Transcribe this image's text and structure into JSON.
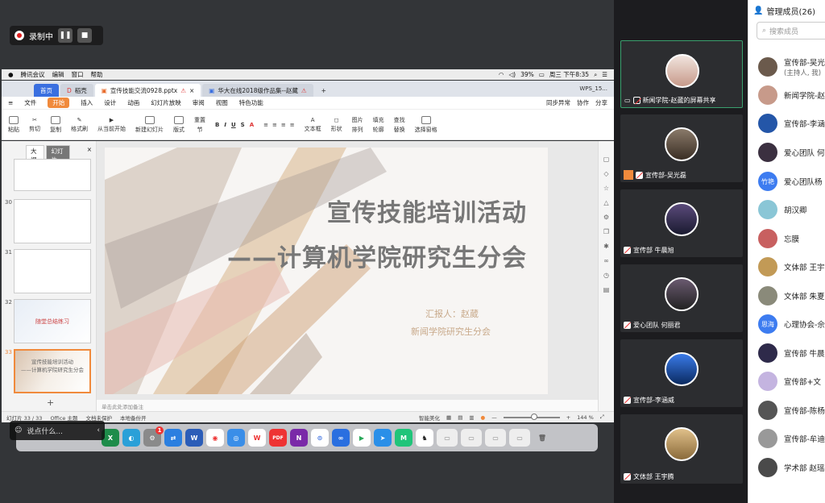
{
  "recording": {
    "label": "录制中"
  },
  "mac_menu": {
    "items": [
      "腾讯会议",
      "编辑",
      "窗口",
      "帮助"
    ],
    "battery": "39%",
    "clock": "周三 下午8:35"
  },
  "wps_tabs": {
    "home": "首页",
    "daoke": "稻壳",
    "doc1": "宣传技能交流0928.pptx",
    "doc2": "华大在线2018级作品集--赵藏",
    "account": "WPS_15..."
  },
  "ribbon": {
    "menus": [
      "文件",
      "开始",
      "插入",
      "设计",
      "动画",
      "幻灯片放映",
      "审阅",
      "视图",
      "特色功能"
    ],
    "right": [
      "同步异常",
      "协作",
      "分享"
    ],
    "tools": [
      "粘贴",
      "剪切",
      "复制",
      "格式刷",
      "从当前开始",
      "新建幻灯片",
      "版式",
      "节",
      "重置",
      "文本框",
      "形状",
      "排列",
      "图片",
      "填充",
      "轮廓",
      "查找",
      "替换",
      "选择窗格"
    ]
  },
  "side_panel": {
    "tab_outline": "大纲",
    "tab_slides": "幻灯片",
    "thumb_numbers": [
      "30",
      "31",
      "32",
      "33"
    ],
    "thumb32_text": "随堂总结练习",
    "thumb33_line1": "宣传技能培训活动",
    "thumb33_line2": "——计算机学院研究生分会"
  },
  "slide": {
    "title": "宣传技能培训活动",
    "subtitle": "——计算机学院研究生分会",
    "reporter": "汇报人：赵葳",
    "org": "新闻学院研究生分会"
  },
  "notes": {
    "placeholder": "单击此处添加备注"
  },
  "status": {
    "slide_count": "幻灯片 33 / 33",
    "theme": "Office 主题",
    "protect": "文档未保护",
    "backup": "本地备份开",
    "beautify": "智能美化",
    "zoom": "144 %"
  },
  "chat": {
    "placeholder": "说点什么..."
  },
  "dock": {
    "badge": "1",
    "apps": [
      "X",
      "W",
      "PDF",
      "N"
    ]
  },
  "videos": [
    {
      "name": "新闻学院-赵葳的屏幕共享",
      "color": "#e8d6d0"
    },
    {
      "name": "宣传部-吴光磊",
      "color": "#6b5a4c"
    },
    {
      "name": "宣传部 牛晨旭",
      "color": "#2e2a4a"
    },
    {
      "name": "爱心团队 何丽君",
      "color": "#3b3040"
    },
    {
      "name": "宣传部-李涵威",
      "color": "#2456a8"
    },
    {
      "name": "文体部 王宇腾",
      "color": "#c29a56"
    }
  ],
  "members": {
    "header": "管理成员(26)",
    "search_placeholder": "搜索成员",
    "list": [
      {
        "name": "宣传部-吴光",
        "sub": "(主持人, 我)",
        "avatar": "",
        "color": "#6b5a4c"
      },
      {
        "name": "新闻学院-赵",
        "avatar": "",
        "color": "#c79a8a"
      },
      {
        "name": "宣传部-李涵",
        "avatar": "",
        "color": "#2456a8"
      },
      {
        "name": "爱心团队 何",
        "avatar": "",
        "color": "#3b3040"
      },
      {
        "name": "爱心团队杨",
        "avatar": "竹艳",
        "color": "#3d7cf0"
      },
      {
        "name": "胡汉卿",
        "avatar": "",
        "color": "#8ac6d6"
      },
      {
        "name": "忘膜",
        "avatar": "",
        "color": "#c86060"
      },
      {
        "name": "文体部 王宇",
        "avatar": "",
        "color": "#c29a56"
      },
      {
        "name": "文体部 朱夏",
        "avatar": "",
        "color": "#8a8a7a"
      },
      {
        "name": "心理协会-佘",
        "avatar": "思海",
        "color": "#3d7cf0"
      },
      {
        "name": "宣传部 牛晨",
        "avatar": "",
        "color": "#2e2a4a"
      },
      {
        "name": "宣传部+文",
        "avatar": "",
        "color": "#c4b4e0"
      },
      {
        "name": "宣传部-陈杨",
        "avatar": "",
        "color": "#555"
      },
      {
        "name": "宣传部-牟迪",
        "avatar": "",
        "color": "#999"
      },
      {
        "name": "学术部 赵瑶",
        "avatar": "",
        "color": "#4a4a4a"
      }
    ]
  }
}
